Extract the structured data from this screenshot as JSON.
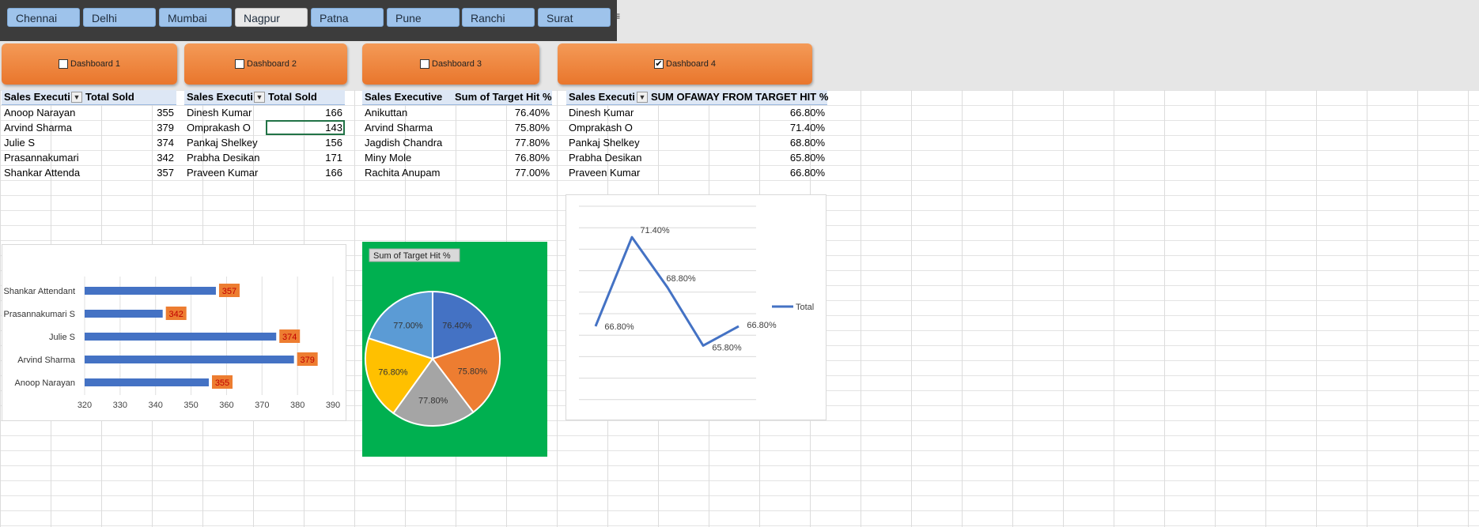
{
  "slicer": {
    "items": [
      "Chennai",
      "Delhi",
      "Mumbai",
      "Nagpur",
      "Patna",
      "Pune",
      "Ranchi",
      "Surat"
    ],
    "selected": "Nagpur"
  },
  "dashboards": [
    {
      "label": "Dashboard 1",
      "checked": false
    },
    {
      "label": "Dashboard 2",
      "checked": false
    },
    {
      "label": "Dashboard 3",
      "checked": false
    },
    {
      "label": "Dashboard 4",
      "checked": true
    }
  ],
  "pivots": [
    {
      "col1": "Sales Executi",
      "col2": "Total Sold",
      "rows": [
        [
          "Anoop Narayan",
          "355"
        ],
        [
          "Arvind Sharma",
          "379"
        ],
        [
          "Julie S",
          "374"
        ],
        [
          "Prasannakumari",
          "342"
        ],
        [
          "Shankar Attenda",
          "357"
        ]
      ]
    },
    {
      "col1": "Sales Executi",
      "col2": "Total Sold",
      "rows": [
        [
          "Dinesh Kumar",
          "166"
        ],
        [
          "Omprakash O",
          "143"
        ],
        [
          "Pankaj Shelkey",
          "156"
        ],
        [
          "Prabha Desikan",
          "171"
        ],
        [
          "Praveen Kumar",
          "166"
        ]
      ]
    },
    {
      "col1": "Sales Executive",
      "col2": "Sum of Target Hit %",
      "rows": [
        [
          "Anikuttan",
          "76.40%"
        ],
        [
          "Arvind Sharma",
          "75.80%"
        ],
        [
          "Jagdish Chandra",
          "77.80%"
        ],
        [
          "Miny Mole",
          "76.80%"
        ],
        [
          "Rachita Anupam",
          "77.00%"
        ]
      ]
    },
    {
      "col1": "Sales Executi",
      "col2": "SUM OFAWAY FROM TARGET HIT %",
      "rows": [
        [
          "Dinesh Kumar",
          "66.80%"
        ],
        [
          "Omprakash O",
          "71.40%"
        ],
        [
          "Pankaj Shelkey",
          "68.80%"
        ],
        [
          "Prabha Desikan",
          "65.80%"
        ],
        [
          "Praveen Kumar",
          "66.80%"
        ]
      ]
    }
  ],
  "chart_data": [
    {
      "type": "bar",
      "orientation": "horizontal",
      "categories": [
        "Anoop Narayan",
        "Arvind Sharma",
        "Julie S",
        "Prasannakumari S",
        "Shankar Attendant"
      ],
      "values": [
        355,
        379,
        374,
        342,
        357
      ],
      "xlim": [
        320,
        390
      ],
      "ticks": [
        320,
        330,
        340,
        350,
        360,
        370,
        380,
        390
      ],
      "bar_color": "#4472c4",
      "label_bg": "#ed7d31",
      "label_color": "#c00000",
      "grid": true
    },
    {
      "type": "pie",
      "title": "Sum of Target Hit %",
      "values": [
        76.4,
        75.8,
        77.8,
        76.8,
        77.0
      ],
      "labels": [
        "76.40%",
        "75.80%",
        "77.80%",
        "76.80%",
        "77.00%"
      ],
      "colors": [
        "#4472c4",
        "#ed7d31",
        "#a5a5a5",
        "#ffc000",
        "#5b9bd5"
      ],
      "background": "#00b050"
    },
    {
      "type": "line",
      "values": [
        66.8,
        71.4,
        68.8,
        65.8,
        66.8
      ],
      "labels": [
        "66.80%",
        "71.40%",
        "68.80%",
        "65.80%",
        "66.80%"
      ],
      "series": [
        {
          "name": "Total"
        }
      ],
      "legend": "right",
      "ylim": [
        63,
        73
      ],
      "color": "#4472c4",
      "grid": true
    }
  ]
}
